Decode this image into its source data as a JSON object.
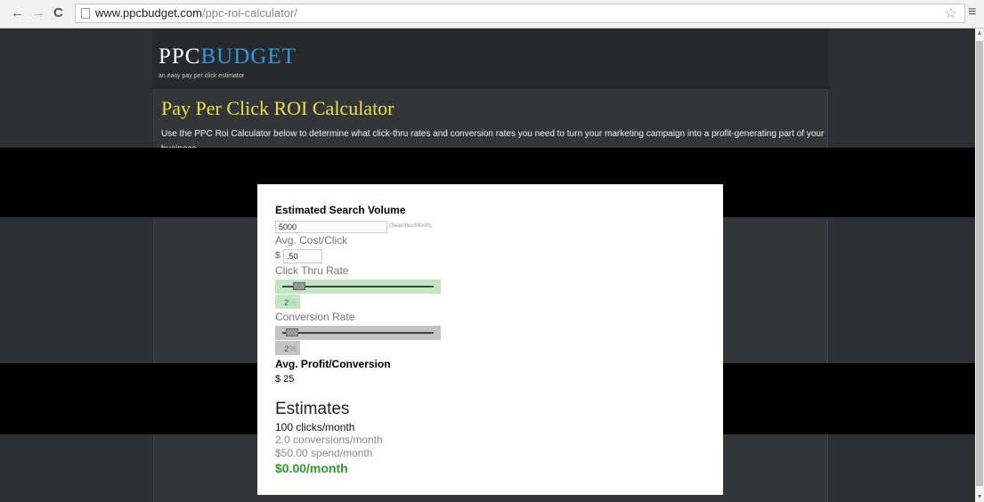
{
  "browser": {
    "url_host": "www.ppcbudget.com",
    "url_path": "/ppc-roi-calculator/"
  },
  "site": {
    "logo_part1": "PPC",
    "logo_part2": "BUDGET",
    "tagline": "an easy pay per click estimator",
    "headline": "Pay Per Click ROI Calculator",
    "intro": "Use the PPC Roi Calculator below to determine what click-thru rates and conversion rates you need to turn your marketing campaign into a profit-generating part of your business."
  },
  "calculator": {
    "search_volume_label": "Estimated Search Volume",
    "search_volume_value": "5000",
    "search_volume_units": "(Searches/Month)",
    "cost_label": "Avg. Cost/Click",
    "currency_symbol": "$",
    "cost_value": ".50",
    "ctr_label": "Click Thru Rate",
    "ctr_value": "2",
    "conversion_label": "Conversion Rate",
    "conversion_value": "2",
    "percent_symbol": "%",
    "profit_label": "Avg. Profit/Conversion",
    "profit_value": "$ 25"
  },
  "estimates": {
    "title": "Estimates",
    "clicks": "100 clicks/month",
    "conversions": "2.0 conversions/month",
    "spend": "$50.00 spend/month",
    "profit": "$0.00/month"
  },
  "colors": {
    "headline": "#e4e24a",
    "logo_accent": "#2d9ae0",
    "profit_green": "#2e9b2e",
    "ctr_slider_bg": "#c3e6c2",
    "conversion_slider_bg": "#c4c4c4"
  }
}
